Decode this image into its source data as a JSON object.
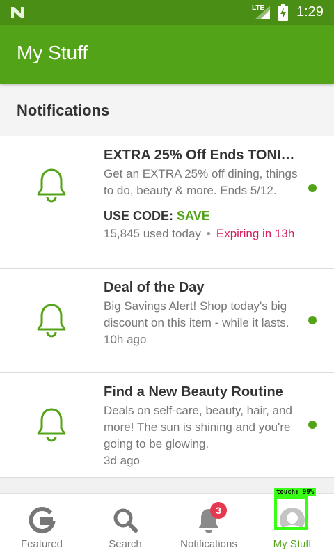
{
  "status_bar": {
    "network": "LTE",
    "time": "1:29"
  },
  "app_bar": {
    "title": "My Stuff"
  },
  "section": {
    "title": "Notifications"
  },
  "notifications": [
    {
      "title": "EXTRA 25% Off Ends TONI…",
      "description": "Get an EXTRA 25% off dining, things to do, beauty & more. Ends 5/12.",
      "code_label": "USE CODE:",
      "code": "SAVE",
      "used": "15,845 used today",
      "separator": "•",
      "expiring": "Expiring in 13h",
      "unread": true
    },
    {
      "title": "Deal of the Day",
      "description": "Big Savings Alert! Shop today's big discount on this item - while it lasts.",
      "time": "10h ago",
      "unread": true
    },
    {
      "title": "Find a New Beauty Routine",
      "description": "Deals on self-care, beauty, hair, and more! The sun is shining and you're going to be glowing.",
      "time": "3d ago",
      "unread": true
    }
  ],
  "bottom_nav": {
    "items": [
      {
        "label": "Featured",
        "icon": "featured-g-icon"
      },
      {
        "label": "Search",
        "icon": "search-icon"
      },
      {
        "label": "Notifications",
        "icon": "bell-icon",
        "badge": "3"
      },
      {
        "label": "My Stuff",
        "icon": "profile-icon",
        "active": true
      }
    ]
  },
  "overlay": {
    "touch_label": "touch: 99%"
  },
  "colors": {
    "brand": "#53a318",
    "status_bar": "#4b8e15",
    "expiring": "#d81b60",
    "badge": "#e53950",
    "touch": "#39ff14"
  }
}
